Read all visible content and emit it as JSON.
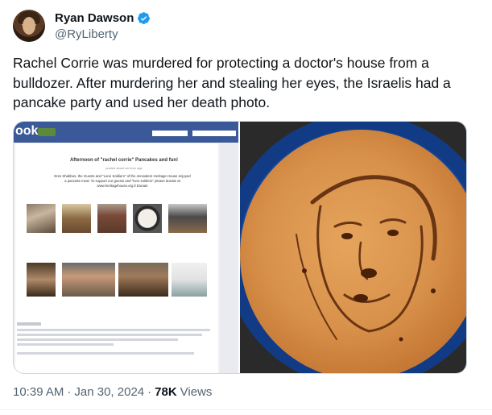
{
  "author": {
    "name": "Ryan Dawson",
    "handle": "@RyLiberty"
  },
  "tweet": {
    "text": "Rachel Corrie was murdered for protecting a doctor's house from a bulldozer. After murdering her and stealing her eyes, the Israelis had a pancake party and used her death photo."
  },
  "media": {
    "left": {
      "fb_logo": "ook",
      "post_title": "Afternoon of \"rachel corrie\" Pancakes and fun!",
      "post_sub": "posted about an hour ago",
      "post_body": "Eres Shabbos, the Guests and \"Lone Soldiers\" of the Jerusalem Heritage House enjoyed a pancake meal. To support our guests and \"lone soldiers\" please donate at www.heritagehouse.org.il Donate"
    }
  },
  "meta": {
    "time": "10:39 AM",
    "sep1": "·",
    "date": "Jan 30, 2024",
    "sep2": "·",
    "views_count": "78K",
    "views_label": "Views"
  },
  "colors": {
    "verified": "#1d9bf0",
    "facebook": "#3b5998",
    "muted": "#536471"
  },
  "icons": [
    "verified-badge-icon"
  ]
}
